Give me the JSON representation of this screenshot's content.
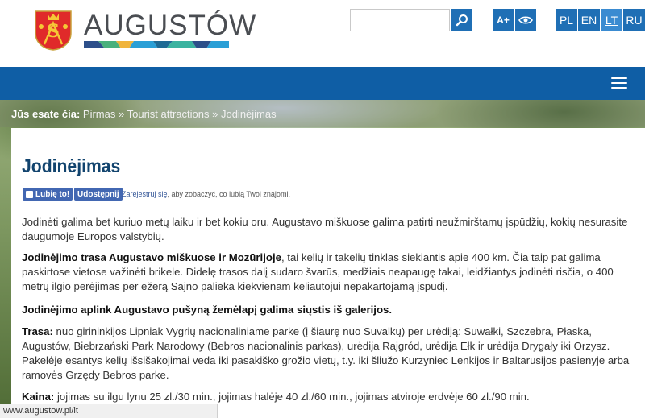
{
  "header": {
    "brand": "AUGUSTÓW",
    "search": {
      "value": "",
      "placeholder": ""
    },
    "font_size_label": "A+",
    "languages": [
      {
        "code": "PL",
        "active": false
      },
      {
        "code": "EN",
        "active": false
      },
      {
        "code": "LT",
        "active": true
      },
      {
        "code": "RU",
        "active": false
      }
    ],
    "colors": {
      "nav": "#0f5ea5",
      "button": "#1f6fb5",
      "title": "#12446e"
    }
  },
  "breadcrumb": {
    "prefix": "Jūs esate čia:",
    "items": [
      "Pirmas",
      "Tourist attractions",
      "Jodinėjimas"
    ],
    "separator": "»"
  },
  "page": {
    "title": "Jodinėjimas",
    "fb": {
      "like": "Lubię to!",
      "share": "Udostępnij",
      "register_link": "Zarejestruj się",
      "register_rest": ", aby zobaczyć, co lubią Twoi znajomi."
    },
    "p1": "Jodinėti galima bet kuriuo metų laiku ir bet kokiu oru. Augustavo miškuose galima patirti neužmirštamų įspūdžių, kokių nesurasite daugumoje Europos valstybių.",
    "p2_bold": "Jodinėjimo trasa Augustavo miškuose ir Mozūrijoje",
    "p2_rest": ", tai kelių ir takelių tinklas siekiantis apie 400 km. Čia taip pat galima paskirtose vietose važinėti brikele. Didelę trasos dalį sudaro švarūs, medžiais neapaugę takai, leidžiantys jodinėti risčia, o 400 metrų ilgio perėjimas per ežerą Sajno palieka kiekvienam keliautojui nepakartojamą įspūdį.",
    "p3_bold": "Jodinėjimo aplink Augustavo pušyną žemėlapį galima siųstis iš galerijos.",
    "p4_bold": "Trasa:",
    "p4_rest": " nuo girininkijos Lipniak Vygrių nacionaliniame parke (į šiaurę nuo Suvalkų) per urėdiją: Suwałki, Szczebra, Płaska, Augustów, Biebrzański Park Narodowy (Bebros nacionalinis parkas), urėdija Rajgród, urėdija Ełk ir urėdija Drygały iki Orzysz. Pakelėje esantys kelių išsišakojimai veda iki pasakiško grožio vietų, t.y. iki šliužo Kurzyniec Lenkijos ir Baltarusijos pasienyje arba ramovės Grzędy Bebros parke.",
    "p5_bold": "Kaina:",
    "p5_rest": " jojimas su ilgu lynu 25 zl./30 min., jojimas halėje 40 zl./60 min., jojimas atviroje erdvėje 60 zl./90 min."
  },
  "status_url": "www.augustow.pl/lt"
}
